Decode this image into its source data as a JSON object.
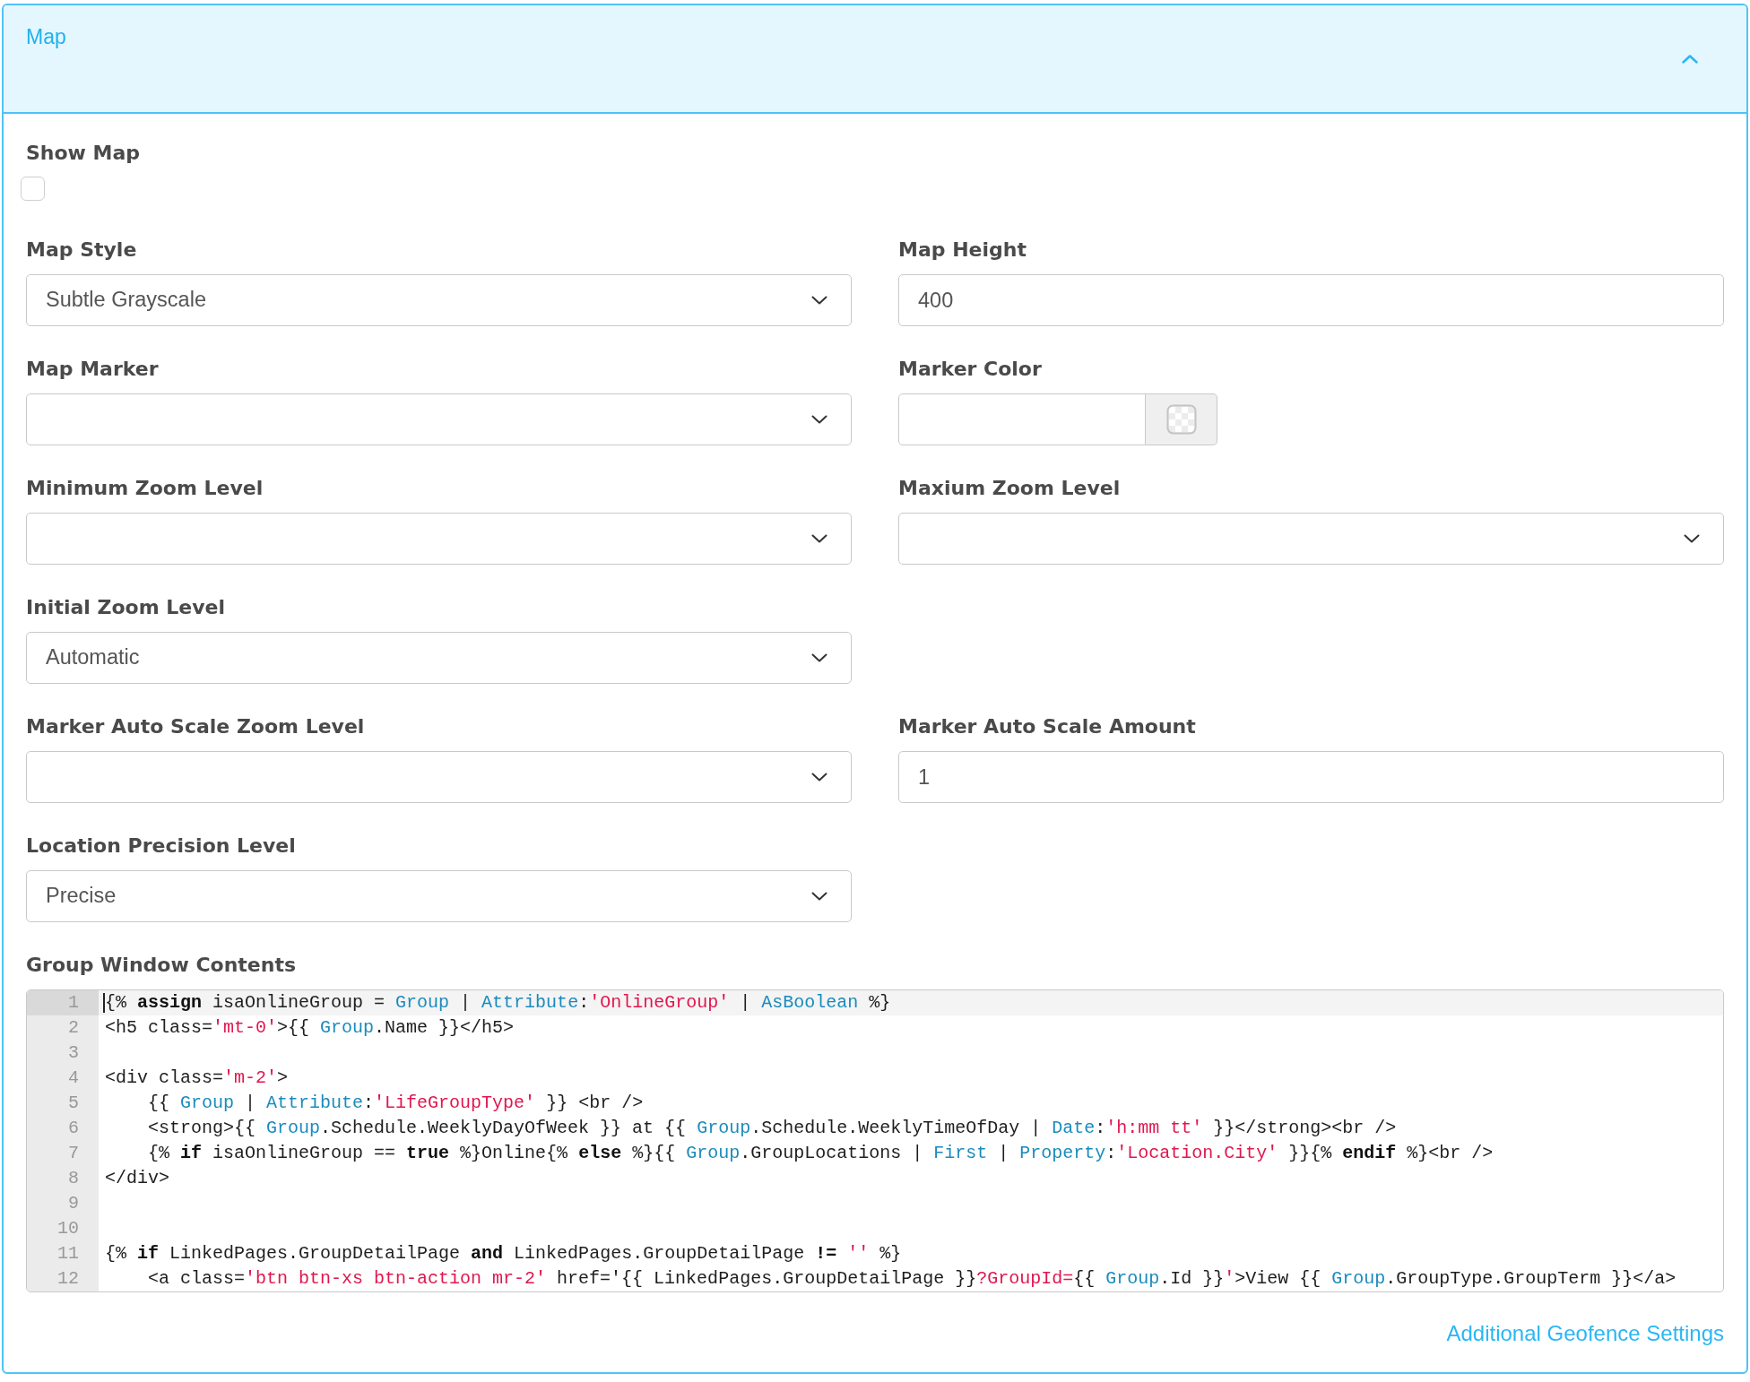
{
  "panel": {
    "title": "Map",
    "expanded": true
  },
  "show_map": {
    "label": "Show Map",
    "checked": false
  },
  "rows": [
    [
      {
        "label": "Map Style",
        "kind": "select",
        "value": "Subtle Grayscale"
      },
      {
        "label": "Map Height",
        "kind": "text",
        "value": "400"
      }
    ],
    [
      {
        "label": "Map Marker",
        "kind": "select"
      },
      {
        "label": "Marker Color",
        "kind": "color"
      }
    ],
    [
      {
        "label": "Minimum Zoom Level",
        "kind": "select"
      },
      {
        "label": "Maxium Zoom Level",
        "kind": "select"
      }
    ],
    [
      {
        "label": "Initial Zoom Level",
        "kind": "select",
        "value": "Automatic"
      }
    ],
    [
      {
        "label": "Marker Auto Scale Zoom Level",
        "kind": "select"
      },
      {
        "label": "Marker Auto Scale Amount",
        "kind": "text",
        "value": "1"
      }
    ],
    [
      {
        "label": "Location Precision Level",
        "kind": "select",
        "value": "Precise"
      }
    ]
  ],
  "editor": {
    "label": "Group Window Contents",
    "lines": [
      {
        "number": "1",
        "active": true,
        "tokens": [
          {
            "kind": "plain",
            "text": "{% "
          },
          {
            "kind": "keyword",
            "text": "assign"
          },
          {
            "kind": "plain",
            "text": " isaOnlineGroup = "
          },
          {
            "kind": "name",
            "text": "Group"
          },
          {
            "kind": "plain",
            "text": " | "
          },
          {
            "kind": "name",
            "text": "Attribute"
          },
          {
            "kind": "plain",
            "text": ":"
          },
          {
            "kind": "string",
            "text": "'OnlineGroup'"
          },
          {
            "kind": "plain",
            "text": " | "
          },
          {
            "kind": "name",
            "text": "AsBoolean"
          },
          {
            "kind": "plain",
            "text": " %}"
          }
        ]
      },
      {
        "number": "2",
        "active": false,
        "tokens": [
          {
            "kind": "plain",
            "text": "<h5 class="
          },
          {
            "kind": "string",
            "text": "'mt-0'"
          },
          {
            "kind": "plain",
            "text": ">{{ "
          },
          {
            "kind": "name",
            "text": "Group"
          },
          {
            "kind": "plain",
            "text": ".Name }}</h5>"
          }
        ]
      },
      {
        "number": "3",
        "active": false
      },
      {
        "number": "4",
        "active": false,
        "tokens": [
          {
            "kind": "plain",
            "text": "<div class="
          },
          {
            "kind": "string",
            "text": "'m-2'"
          },
          {
            "kind": "plain",
            "text": ">"
          }
        ]
      },
      {
        "number": "5",
        "active": false,
        "tokens": [
          {
            "kind": "plain",
            "text": "    {{ "
          },
          {
            "kind": "name",
            "text": "Group"
          },
          {
            "kind": "plain",
            "text": " | "
          },
          {
            "kind": "name",
            "text": "Attribute"
          },
          {
            "kind": "plain",
            "text": ":"
          },
          {
            "kind": "string",
            "text": "'LifeGroupType'"
          },
          {
            "kind": "plain",
            "text": " }} <br />"
          }
        ]
      },
      {
        "number": "6",
        "active": false,
        "tokens": [
          {
            "kind": "plain",
            "text": "    <strong>{{ "
          },
          {
            "kind": "name",
            "text": "Group"
          },
          {
            "kind": "plain",
            "text": ".Schedule.WeeklyDayOfWeek }} at {{ "
          },
          {
            "kind": "name",
            "text": "Group"
          },
          {
            "kind": "plain",
            "text": ".Schedule.WeeklyTimeOfDay | "
          },
          {
            "kind": "name",
            "text": "Date"
          },
          {
            "kind": "plain",
            "text": ":"
          },
          {
            "kind": "string",
            "text": "'h:mm tt'"
          },
          {
            "kind": "plain",
            "text": " }}</strong><br />"
          }
        ]
      },
      {
        "number": "7",
        "active": false,
        "tokens": [
          {
            "kind": "plain",
            "text": "    {% "
          },
          {
            "kind": "keyword",
            "text": "if"
          },
          {
            "kind": "plain",
            "text": " isaOnlineGroup == "
          },
          {
            "kind": "keyword",
            "text": "true"
          },
          {
            "kind": "plain",
            "text": " %}Online{% "
          },
          {
            "kind": "keyword",
            "text": "else"
          },
          {
            "kind": "plain",
            "text": " %}{{ "
          },
          {
            "kind": "name",
            "text": "Group"
          },
          {
            "kind": "plain",
            "text": ".GroupLocations | "
          },
          {
            "kind": "name",
            "text": "First"
          },
          {
            "kind": "plain",
            "text": " | "
          },
          {
            "kind": "name",
            "text": "Property"
          },
          {
            "kind": "plain",
            "text": ":"
          },
          {
            "kind": "string",
            "text": "'Location.City'"
          },
          {
            "kind": "plain",
            "text": " }}{% "
          },
          {
            "kind": "keyword",
            "text": "endif"
          },
          {
            "kind": "plain",
            "text": " %}<br />"
          }
        ]
      },
      {
        "number": "8",
        "active": false,
        "tokens": [
          {
            "kind": "plain",
            "text": "</div>"
          }
        ]
      },
      {
        "number": "9",
        "active": false
      },
      {
        "number": "10",
        "active": false
      },
      {
        "number": "11",
        "active": false,
        "tokens": [
          {
            "kind": "plain",
            "text": "{% "
          },
          {
            "kind": "keyword",
            "text": "if"
          },
          {
            "kind": "plain",
            "text": " LinkedPages.GroupDetailPage "
          },
          {
            "kind": "keyword",
            "text": "and"
          },
          {
            "kind": "plain",
            "text": " LinkedPages.GroupDetailPage "
          },
          {
            "kind": "keyword",
            "text": "!= "
          },
          {
            "kind": "string",
            "text": "''"
          },
          {
            "kind": "plain",
            "text": " %}"
          }
        ]
      },
      {
        "number": "12",
        "active": false,
        "tokens": [
          {
            "kind": "plain",
            "text": "    <a class="
          },
          {
            "kind": "string",
            "text": "'btn btn-xs btn-action mr-2'"
          },
          {
            "kind": "plain",
            "text": " href='{{ LinkedPages.GroupDetailPage }}"
          },
          {
            "kind": "string",
            "text": "?GroupId="
          },
          {
            "kind": "plain",
            "text": "{{ "
          },
          {
            "kind": "name",
            "text": "Group"
          },
          {
            "kind": "plain",
            "text": ".Id }}"
          },
          {
            "kind": "string",
            "text": "'"
          },
          {
            "kind": "plain",
            "text": ">View {{ "
          },
          {
            "kind": "name",
            "text": "Group"
          },
          {
            "kind": "plain",
            "text": ".GroupType.GroupTerm }}</a>"
          }
        ]
      }
    ]
  },
  "link": {
    "label": "Additional Geofence Settings"
  }
}
